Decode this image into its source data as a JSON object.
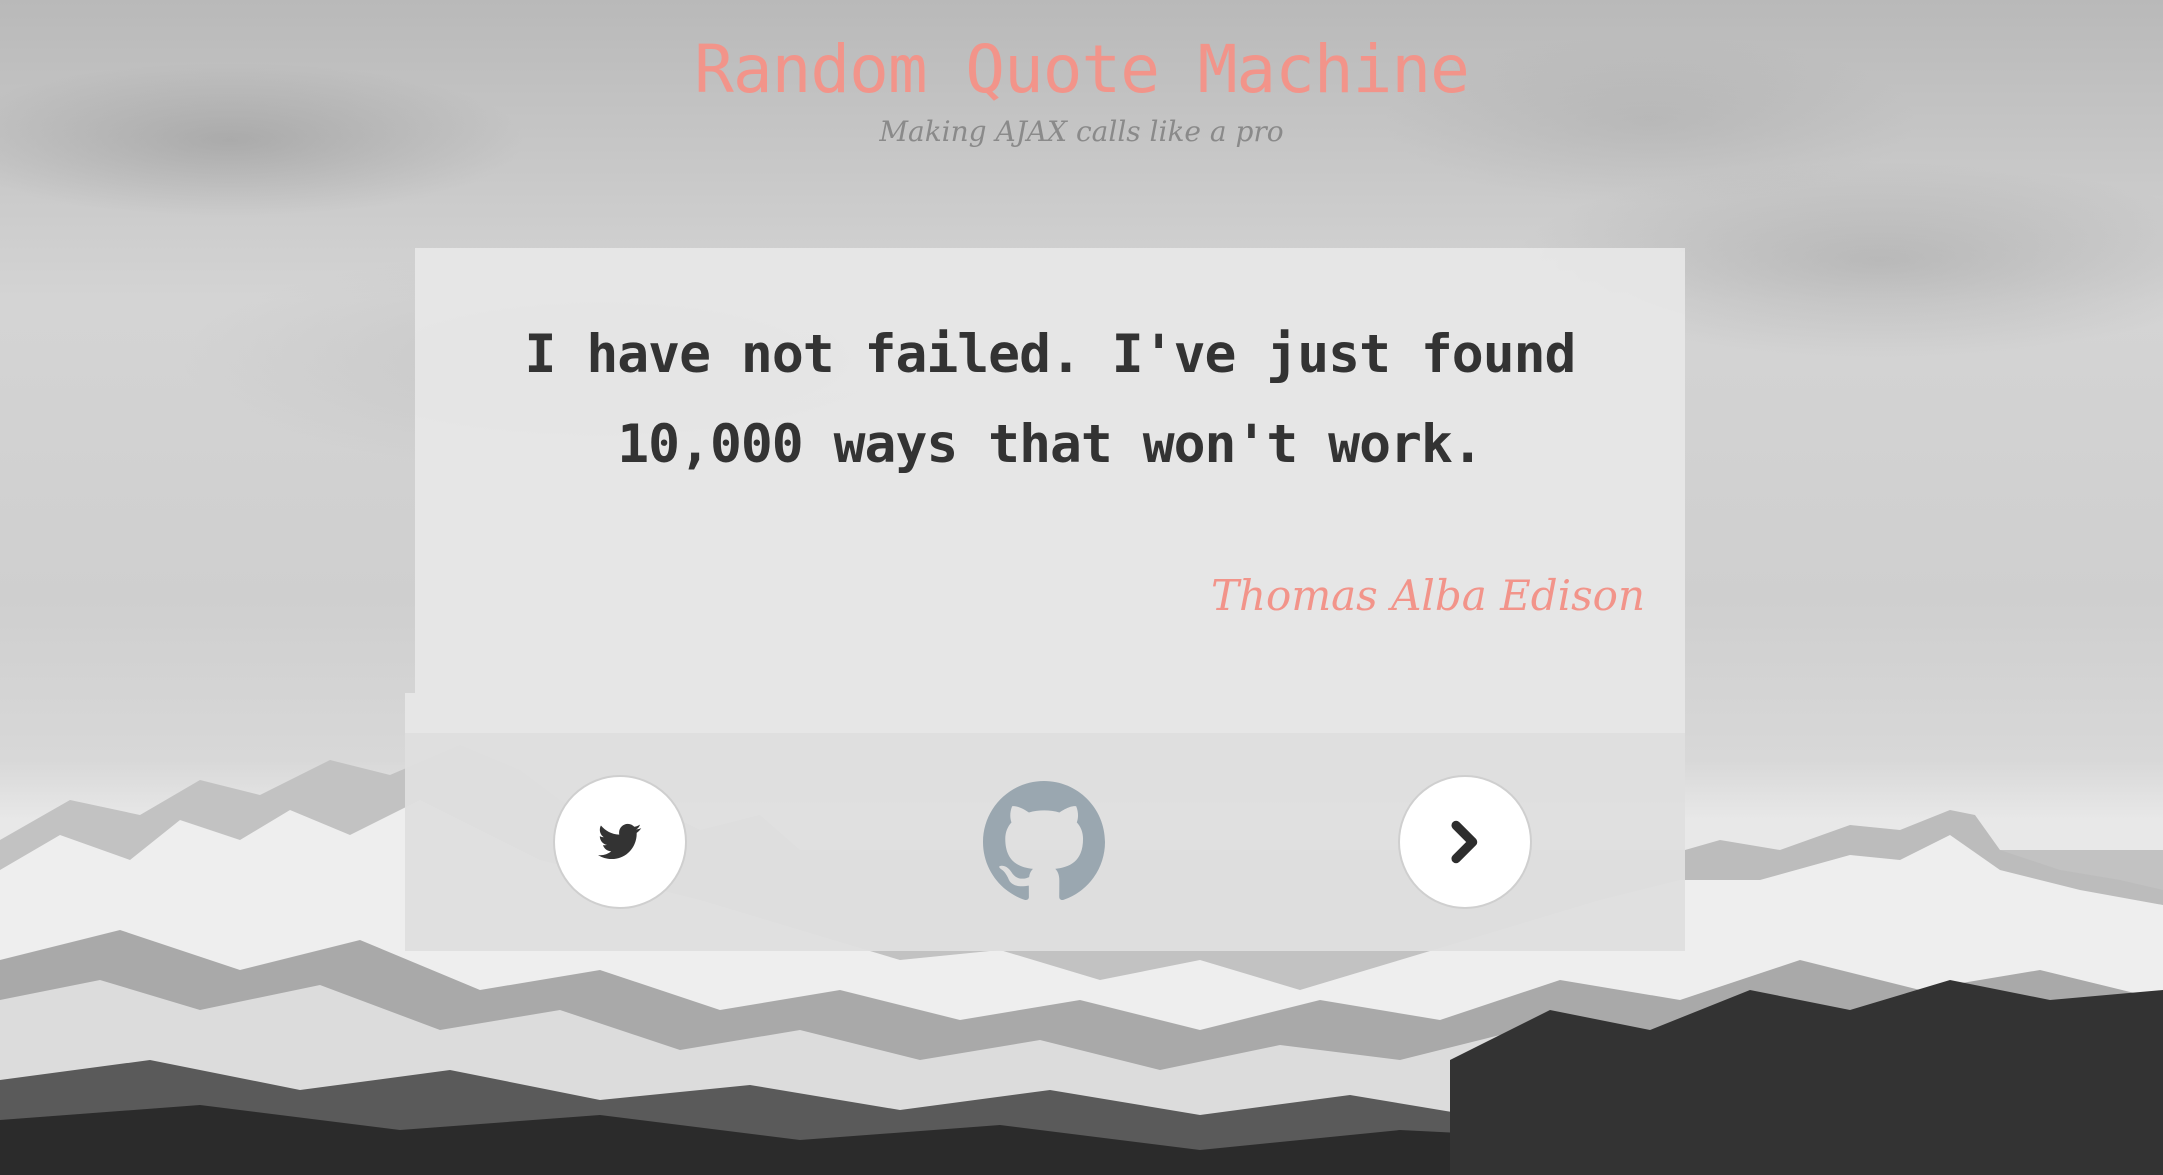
{
  "header": {
    "title": "Random Quote Machine",
    "subtitle": "Making AJAX calls like a pro"
  },
  "quote": {
    "text": "I have not failed. I've just found 10,000 ways that won't work.",
    "author": "Thomas Alba Edison"
  },
  "actions": {
    "tweet_icon": "twitter-icon",
    "github_icon": "github-octocat-icon",
    "next_icon": "chevron-right-icon"
  },
  "colors": {
    "accent": "#f2948a",
    "quote_text": "#333333",
    "subtitle": "#8a8a8a",
    "github_icon": "#9aa7b0"
  }
}
